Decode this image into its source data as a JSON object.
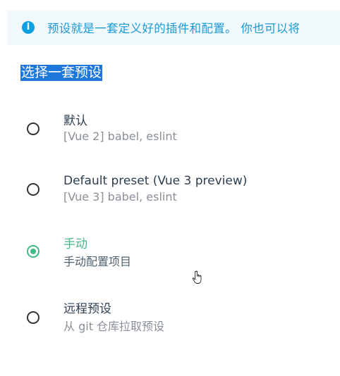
{
  "banner": {
    "icon": "info-icon",
    "icon_glyph": "i",
    "text": "预设就是一套定义好的插件和配置。 你也可以将"
  },
  "section_title": "选择一套预设",
  "options": [
    {
      "label": "默认",
      "description": "[Vue 2] babel, eslint",
      "selected": false
    },
    {
      "label": "Default preset (Vue 3 preview)",
      "description": "[Vue 3] babel, eslint",
      "selected": false
    },
    {
      "label": "手动",
      "description": "手动配置项目",
      "selected": true
    },
    {
      "label": "远程预设",
      "description": "从 git 仓库拉取预设",
      "selected": false
    }
  ],
  "colors": {
    "accent": "#42b983",
    "info": "#0e9fe1",
    "selection_highlight": "#1e78dc"
  }
}
